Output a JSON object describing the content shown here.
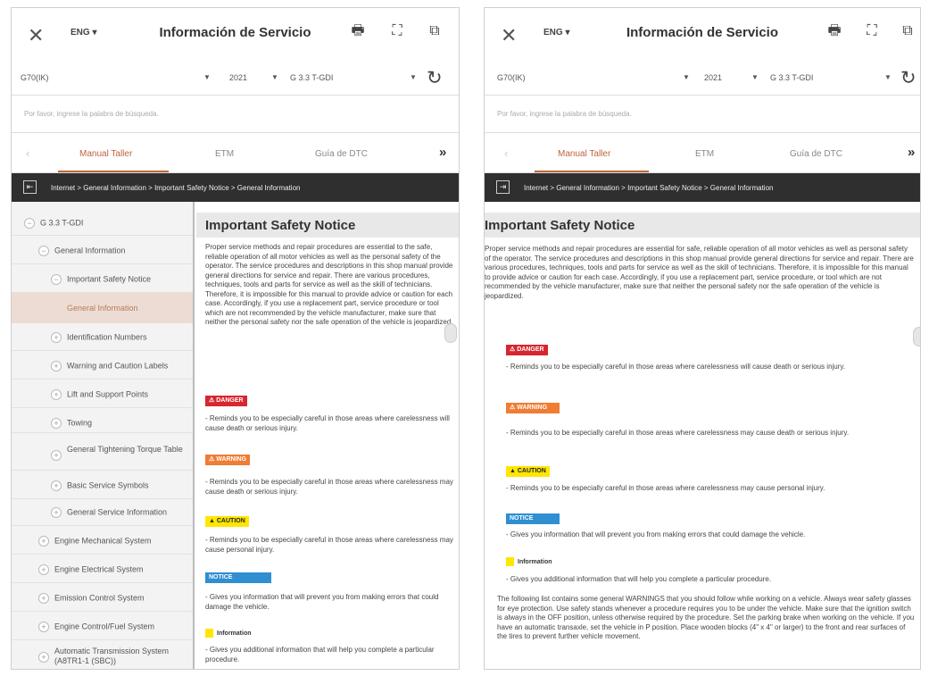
{
  "header": {
    "close_icon": "close-icon",
    "lang": "ENG",
    "title": "Información de Servicio",
    "icons": [
      "print-icon",
      "fullscreen-icon",
      "external-window-icon"
    ]
  },
  "selectors": {
    "model": "G70(IK)",
    "year": "2021",
    "engine": "G 3.3 T-GDI"
  },
  "search": {
    "placeholder": "Por favor, ingrese la palabra de búsqueda."
  },
  "tabs": [
    "Manual Taller",
    "ETM",
    "Guía de DTC"
  ],
  "breadcrumb": "Internet > General Information > Important Safety Notice > General Information",
  "tree": {
    "items": [
      {
        "label": "G 3.3 T-GDI",
        "sign": "−"
      },
      {
        "label": "General Information",
        "sign": "−"
      },
      {
        "label": "Important Safety Notice",
        "sign": "−"
      },
      {
        "label": "General Information",
        "sign": ""
      },
      {
        "label": "Identification Numbers",
        "sign": "+"
      },
      {
        "label": "Warning and Caution Labels",
        "sign": "+"
      },
      {
        "label": "Lift and Support Points",
        "sign": "+"
      },
      {
        "label": "Towing",
        "sign": "+"
      },
      {
        "label": "General Tightening Torque Table",
        "sign": "+"
      },
      {
        "label": "Basic Service Symbols",
        "sign": "+"
      },
      {
        "label": "General Service Information",
        "sign": "+"
      },
      {
        "label": "Engine Mechanical System",
        "sign": "+"
      },
      {
        "label": "Engine Electrical System",
        "sign": "+"
      },
      {
        "label": "Emission Control System",
        "sign": "+"
      },
      {
        "label": "Engine Control/Fuel System",
        "sign": "+"
      },
      {
        "label": "Automatic Transmission System (A8TR1-1 (SBC))",
        "sign": "+"
      }
    ]
  },
  "content": {
    "title": "Important Safety Notice",
    "intro_left": "Proper service methods and repair procedures are essential to the safe, reliable operation of all motor vehicles as well as the personal safety of the operator. The service procedures and descriptions in this shop manual provide general directions for service and repair. There are various procedures, techniques, tools and parts for service as well as the skill of technicians. Therefore, it is impossible for this manual to provide advice or caution for each case. Accordingly, if you use a replacement part, service procedure or tool which are not recommended by the vehicle manufacturer, make sure that neither the personal safety nor the safe operation of the vehicle is jeopardized.",
    "intro_right": "Proper service methods and repair procedures are essential for safe, reliable operation of all motor vehicles as well as personal safety of the operator. The service procedures and descriptions in this shop manual provide general directions for service and repair. There are various procedures, techniques, tools and parts for service as well as the skill of technicians. Therefore, it is impossible for this manual to provide advice or caution for each case. Accordingly, if you use a replacement part, service procedure, or tool which are not recommended by the vehicle manufacturer, make sure that neither the personal safety nor the safe operation of the vehicle is jeopardized.",
    "notices": [
      {
        "kind": "danger",
        "label": "⚠ DANGER",
        "text": "- Reminds you to be especially careful in those areas where carelessness will cause death or serious injury."
      },
      {
        "kind": "warning",
        "label": "⚠ WARNING",
        "text": "- Reminds you to be especially careful in those areas where carelessness may cause death or serious injury."
      },
      {
        "kind": "caution",
        "label": "▲ CAUTION",
        "text": "- Reminds you to be especially careful in those areas where carelessness may cause personal injury."
      },
      {
        "kind": "notice",
        "label": "NOTICE",
        "text": "- Gives you information that will prevent you from making errors that could damage the vehicle."
      },
      {
        "kind": "info",
        "label": "Information",
        "text": "- Gives you additional information that will help you complete a particular procedure."
      }
    ],
    "general": "The following list contains some general WARNINGS that you should follow while working on a vehicle. Always wear safety glasses for eye protection. Use safety stands whenever a procedure requires you to be under the vehicle. Make sure that the ignition switch is always in the OFF position, unless otherwise required by the procedure. Set the parking brake when working on the vehicle. If you have an automatic transaxle, set the vehicle in P position. Place wooden blocks (4\" x 4\" or larger) to the front and rear surfaces of the tires to prevent further vehicle movement."
  }
}
